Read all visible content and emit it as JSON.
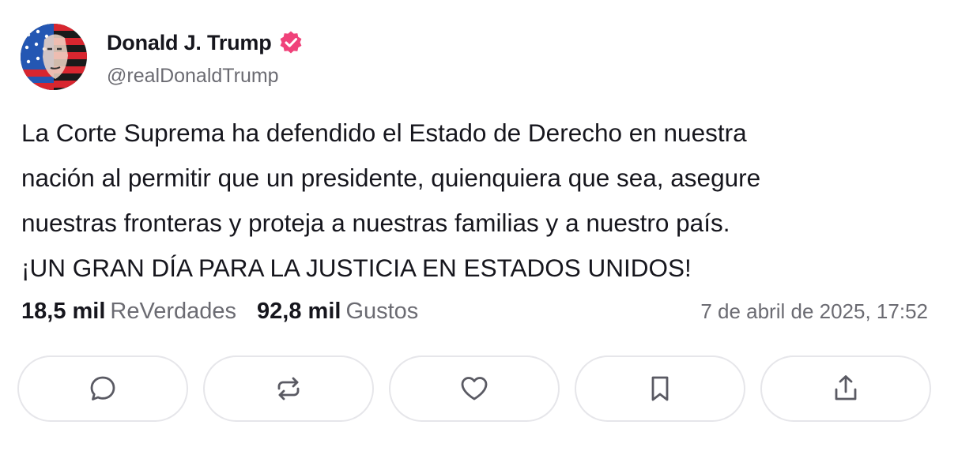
{
  "post": {
    "author": {
      "name": "Donald J. Trump",
      "handle": "@realDonaldTrump",
      "avatar_icon": "flag-portrait-avatar",
      "verified_icon": "verified-badge-icon"
    },
    "text_lines": [
      "La Corte Suprema ha defendido el Estado de Derecho en nuestra",
      "nación al permitir que un presidente, quienquiera que sea, asegure",
      "nuestras fronteras y proteja a nuestras familias y a nuestro país.",
      "¡UN GRAN DÍA PARA LA JUSTICIA EN ESTADOS UNIDOS!"
    ],
    "stats": {
      "reposts_count": "18,5 mil",
      "reposts_label": "ReVerdades",
      "likes_count": "92,8 mil",
      "likes_label": "Gustos"
    },
    "timestamp": "7 de abril de 2025, 17:52"
  },
  "actions": [
    {
      "icon": "reply-icon"
    },
    {
      "icon": "repost-icon"
    },
    {
      "icon": "like-icon"
    },
    {
      "icon": "bookmark-icon"
    },
    {
      "icon": "share-icon"
    }
  ],
  "colors": {
    "text": "#16161d",
    "muted": "#6b6b72",
    "verified": "#f0427a",
    "border": "#e6e6ea",
    "icon": "#5a5a63"
  }
}
